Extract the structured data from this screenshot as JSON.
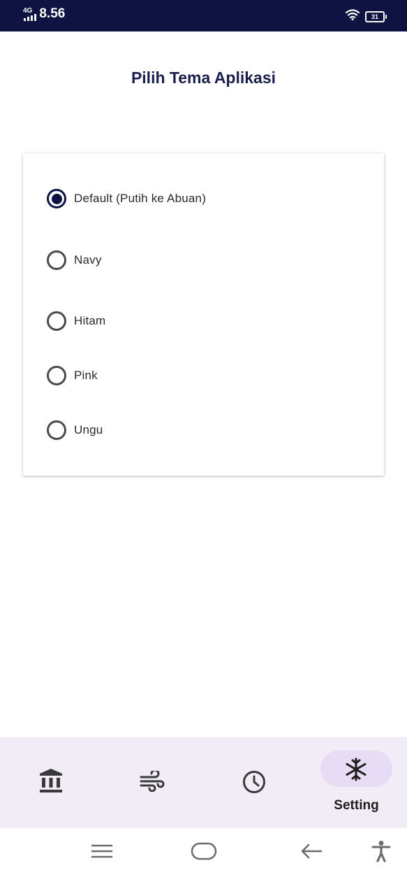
{
  "status_bar": {
    "network": "4G",
    "time": "8.56",
    "battery": "31"
  },
  "page": {
    "title": "Pilih Tema Aplikasi"
  },
  "theme_options": [
    {
      "label": "Default (Putih ke Abuan)",
      "selected": true
    },
    {
      "label": "Navy",
      "selected": false
    },
    {
      "label": "Hitam",
      "selected": false
    },
    {
      "label": "Pink",
      "selected": false
    },
    {
      "label": "Ungu",
      "selected": false
    }
  ],
  "bottom_nav": {
    "items": [
      {
        "icon": "bank-icon"
      },
      {
        "icon": "wind-icon"
      },
      {
        "icon": "clock-icon"
      },
      {
        "icon": "snowflake-icon",
        "label": "Setting",
        "active": true
      }
    ]
  },
  "system_nav": {
    "icons": [
      "menu-icon",
      "home-icon",
      "back-icon",
      "accessibility-icon"
    ]
  },
  "colors": {
    "status_bar": "#0e1342",
    "accent": "#0e1342",
    "title": "#1b1f4e",
    "nav_background": "#f2ecf7",
    "nav_active_pill": "#e7dbf5"
  }
}
